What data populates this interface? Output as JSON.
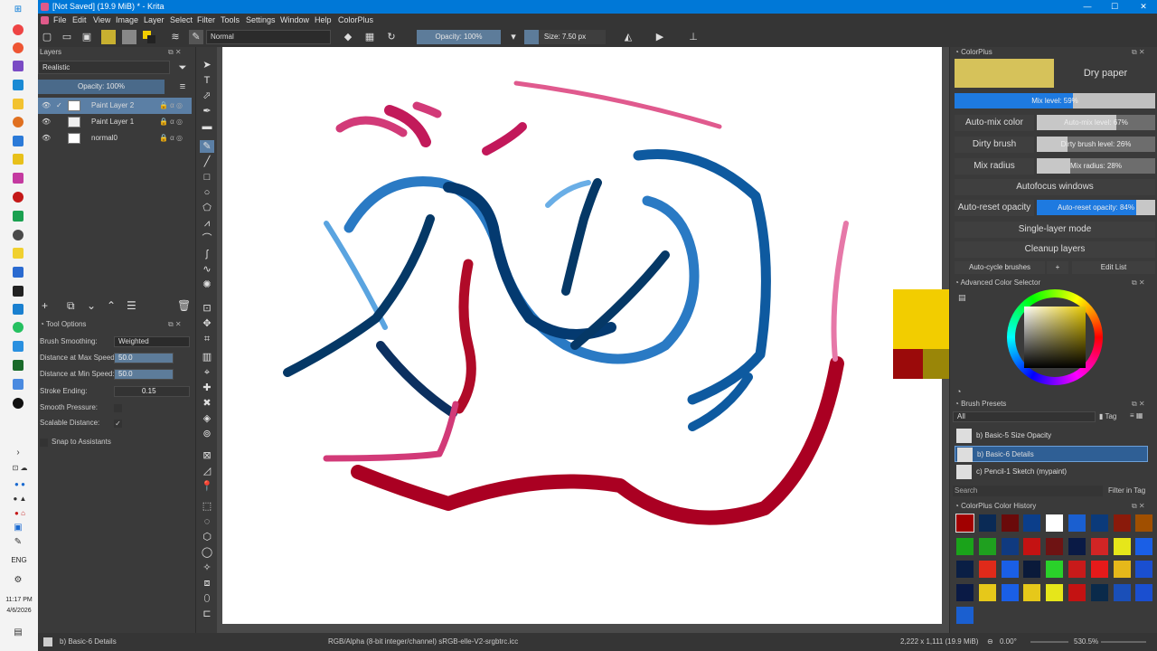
{
  "window": {
    "title": "[Not Saved]  (19.9 MiB) * - Krita",
    "minimize": "—",
    "maximize": "☐",
    "close": "✕"
  },
  "menu": [
    "File",
    "Edit",
    "View",
    "Image",
    "Layer",
    "Select",
    "Filter",
    "Tools",
    "Settings",
    "Window",
    "Help",
    "ColorPlus"
  ],
  "toolbar": {
    "blend_mode": "Normal",
    "opacity": "Opacity: 100%",
    "size": "Size: 7.50 px"
  },
  "layers": {
    "title": "Layers",
    "composite": "Realistic",
    "opacity": "Opacity: 100%",
    "items": [
      "Paint Layer 2",
      "Paint Layer 1",
      "normal0"
    ]
  },
  "tool_options": {
    "title": "Tool Options",
    "brush_smoothing_label": "Brush Smoothing:",
    "brush_smoothing_value": "Weighted",
    "dist_max_label": "Distance at Max Speed:",
    "dist_max_value": "50.0",
    "dist_min_label": "Distance at Min Speed:",
    "dist_min_value": "50.0",
    "stroke_ending_label": "Stroke Ending:",
    "stroke_ending_value": "0.15",
    "smooth_pressure_label": "Smooth Pressure:",
    "scalable_distance_label": "Scalable Distance:",
    "scalable_check": "✓",
    "snap_label": "Snap to Assistants"
  },
  "colorplus": {
    "title": "ColorPlus",
    "dry_paper": "Dry paper",
    "mix_level": "Mix level: 59%",
    "mix_level_value": 0.59,
    "auto_mix_color": "Auto-mix color",
    "auto_mix_level": "Auto-mix level: 67%",
    "auto_mix_level_value": 0.67,
    "dirty_brush": "Dirty brush",
    "dirty_brush_level": "Dirty brush level: 26%",
    "dirty_brush_level_value": 0.26,
    "mix_radius": "Mix radius",
    "mix_radius_value_text": "Mix radius: 28%",
    "mix_radius_value": 0.28,
    "autofocus": "Autofocus windows",
    "auto_reset_opacity": "Auto-reset opacity",
    "auto_reset_opacity_value_text": "Auto-reset opacity: 84%",
    "auto_reset_opacity_value": 0.84,
    "single_layer": "Single-layer mode",
    "cleanup": "Cleanup layers",
    "auto_cycle": "Auto-cycle brushes",
    "plus": "+",
    "edit_list": "Edit List",
    "swatch_color": "#d6c25a"
  },
  "advanced_color_selector": {
    "title": "Advanced Color Selector"
  },
  "brush_presets": {
    "title": "Brush Presets",
    "filter": "All",
    "tag": "Tag",
    "items": [
      "b) Basic-5 Size Opacity",
      "b) Basic-6 Details",
      "c) Pencil-1 Sketch (mypaint)"
    ],
    "search_placeholder": "Search",
    "filter_in_tag": "Filter in Tag"
  },
  "color_history": {
    "title": "ColorPlus Color History",
    "colors": [
      "#a10000",
      "#0a2a55",
      "#6a0a0a",
      "#0b3e8a",
      "#ffffff",
      "#1a5fd0",
      "#0b3a7a",
      "#8a1a0a",
      "#a04f00",
      "#1aa31a",
      "#1fa01f",
      "#103a80",
      "#c41212",
      "#6e1313",
      "#0a1a45",
      "#d12525",
      "#e6e61a",
      "#1a5fe6",
      "#0a1f45",
      "#e02a1a",
      "#1a5fe6",
      "#0a1a3a",
      "#2ad12a",
      "#c81a1a",
      "#e61a1a",
      "#e6b81a",
      "#1a4fd0",
      "#0a1a45",
      "#e6c81a",
      "#1a5fe6",
      "#e6c81a",
      "#e6e61a",
      "#c41212",
      "#0a2a4a",
      "#1a4fb8",
      "#1a4fd0",
      "#1a5fd0"
    ]
  },
  "status": {
    "preset": "b) Basic-6 Details",
    "color_space": "RGB/Alpha (8-bit integer/channel)  sRGB-elle-V2-srgbtrc.icc",
    "dims": "2,222 x 1,111 (19.9 MiB)",
    "rotation": "0.00°",
    "zoom": "530.5%"
  },
  "taskbar": {
    "lang": "ENG",
    "time": "11:17 PM",
    "date": "4/6/2026"
  },
  "fg_color": "#f2cd00",
  "bg_colors": [
    "#9b0a0a",
    "#9a8608"
  ]
}
